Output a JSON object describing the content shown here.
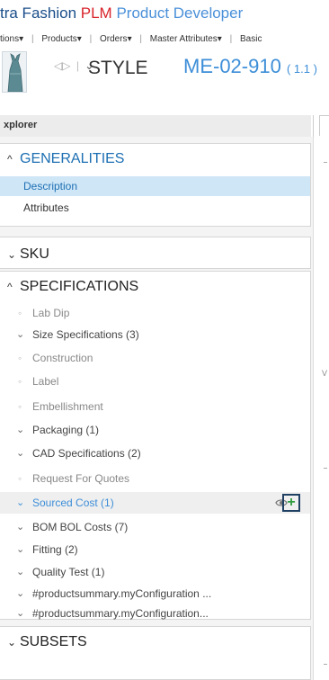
{
  "app": {
    "title_part1": "tra Fashion ",
    "title_part2": "PLM",
    "title_part3": " Product Developer"
  },
  "menu": [
    "tions",
    "Products",
    "Orders",
    "Master Attributes",
    "Basic"
  ],
  "style": {
    "label": "STYLE",
    "code": "ME-02-910",
    "version": "( 1.1 )"
  },
  "explorer": {
    "title": "xplorer"
  },
  "generalities": {
    "title": "GENERALITIES",
    "items": [
      "Description",
      "Attributes"
    ],
    "selected": "Description"
  },
  "sku": {
    "title": "SKU"
  },
  "specifications": {
    "title": "SPECIFICATIONS",
    "items": [
      "Lab Dip",
      "Size Specifications (3)",
      "Construction",
      "Label",
      "Embellishment",
      "Packaging (1)",
      "CAD Specifications (2)",
      "Request For Quotes",
      "Sourced Cost (1)",
      "BOM BOL Costs (7)",
      "Fitting (2)",
      "Quality Test (1)",
      "#productsummary.myConfiguration ...",
      "#productsummary.myConfiguration..."
    ]
  },
  "subsets": {
    "title": "SUBSETS"
  },
  "right_pane": {
    "mark": "V"
  },
  "colors": {
    "accent": "#3d8ed8",
    "selected_bg": "#cfe6f7",
    "plus_green": "#2e9c3e",
    "plus_border": "#1f3f63"
  },
  "icons": {
    "eye": "eye-icon",
    "plus": "plus-icon",
    "nav": "nav-arrows-icon"
  }
}
